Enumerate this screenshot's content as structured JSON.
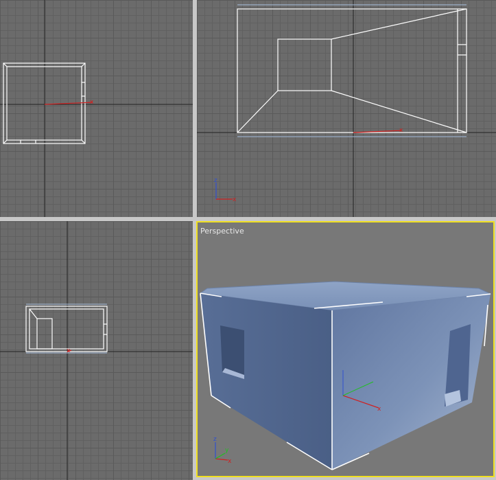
{
  "viewports": {
    "top": {
      "label": ""
    },
    "front": {
      "label": ""
    },
    "left": {
      "label": ""
    },
    "perspective": {
      "label": "Perspective"
    }
  },
  "axis_labels": {
    "x": "x",
    "y": "y",
    "z": "z"
  },
  "colors": {
    "viewport_bg": "#6b6b6b",
    "active_border": "#f0e020",
    "wire": "#ffffff",
    "axis_x": "#d02020",
    "axis_y": "#20c020",
    "axis_z": "#3050d0",
    "model": "#6e86ab"
  },
  "icons": [
    "axis-tripod-icon",
    "pivot-gizmo-icon"
  ]
}
